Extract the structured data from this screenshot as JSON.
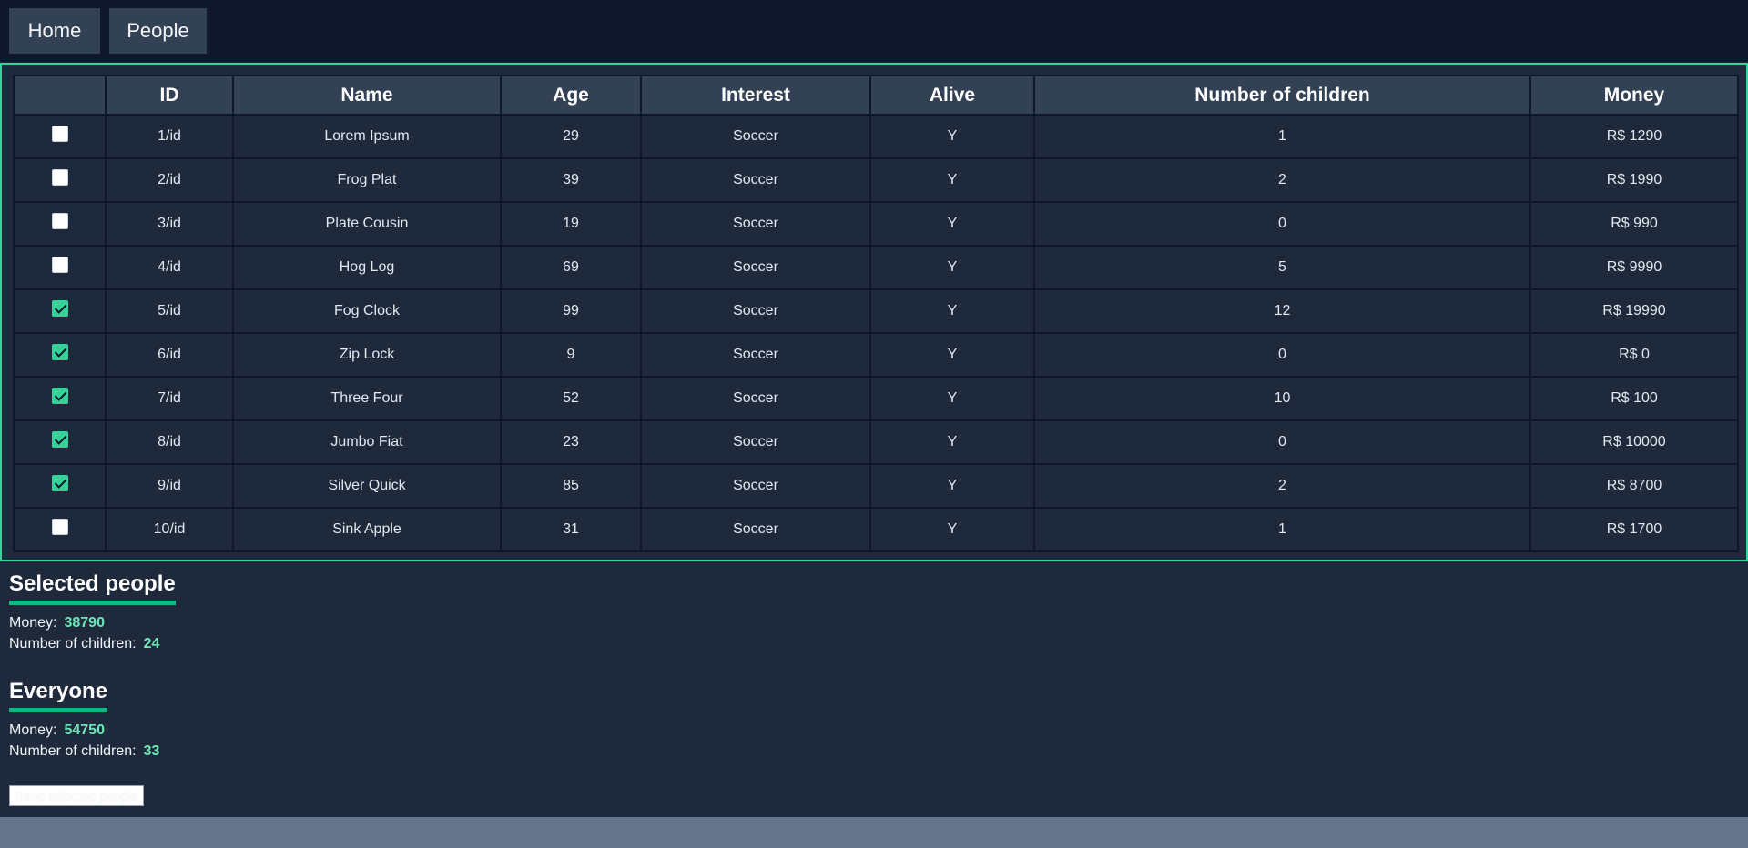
{
  "nav": {
    "home": "Home",
    "people": "People"
  },
  "table": {
    "headers": [
      "",
      "ID",
      "Name",
      "Age",
      "Interest",
      "Alive",
      "Number of children",
      "Money"
    ],
    "rows": [
      {
        "checked": false,
        "id": "1/id",
        "name": "Lorem Ipsum",
        "age": "29",
        "interest": "Soccer",
        "alive": "Y",
        "children": "1",
        "money": "R$ 1290"
      },
      {
        "checked": false,
        "id": "2/id",
        "name": "Frog Plat",
        "age": "39",
        "interest": "Soccer",
        "alive": "Y",
        "children": "2",
        "money": "R$ 1990"
      },
      {
        "checked": false,
        "id": "3/id",
        "name": "Plate Cousin",
        "age": "19",
        "interest": "Soccer",
        "alive": "Y",
        "children": "0",
        "money": "R$ 990"
      },
      {
        "checked": false,
        "id": "4/id",
        "name": "Hog Log",
        "age": "69",
        "interest": "Soccer",
        "alive": "Y",
        "children": "5",
        "money": "R$ 9990"
      },
      {
        "checked": true,
        "id": "5/id",
        "name": "Fog Clock",
        "age": "99",
        "interest": "Soccer",
        "alive": "Y",
        "children": "12",
        "money": "R$ 19990"
      },
      {
        "checked": true,
        "id": "6/id",
        "name": "Zip Lock",
        "age": "9",
        "interest": "Soccer",
        "alive": "Y",
        "children": "0",
        "money": "R$ 0"
      },
      {
        "checked": true,
        "id": "7/id",
        "name": "Three Four",
        "age": "52",
        "interest": "Soccer",
        "alive": "Y",
        "children": "10",
        "money": "R$ 100"
      },
      {
        "checked": true,
        "id": "8/id",
        "name": "Jumbo Fiat",
        "age": "23",
        "interest": "Soccer",
        "alive": "Y",
        "children": "0",
        "money": "R$ 10000"
      },
      {
        "checked": true,
        "id": "9/id",
        "name": "Silver Quick",
        "age": "85",
        "interest": "Soccer",
        "alive": "Y",
        "children": "2",
        "money": "R$ 8700"
      },
      {
        "checked": false,
        "id": "10/id",
        "name": "Sink Apple",
        "age": "31",
        "interest": "Soccer",
        "alive": "Y",
        "children": "1",
        "money": "R$ 1700"
      }
    ]
  },
  "selected": {
    "title": "Selected people",
    "money_label": "Money:",
    "money": "38790",
    "children_label": "Number of children:",
    "children": "24"
  },
  "everyone": {
    "title": "Everyone",
    "money_label": "Money:",
    "money": "54750",
    "children_label": "Number of children:",
    "children": "33"
  },
  "send_button": "Send selected people",
  "colors": {
    "accent": "#34d399",
    "background": "#1e293b",
    "nav_background": "#0f172a",
    "header_cell": "#334155"
  }
}
